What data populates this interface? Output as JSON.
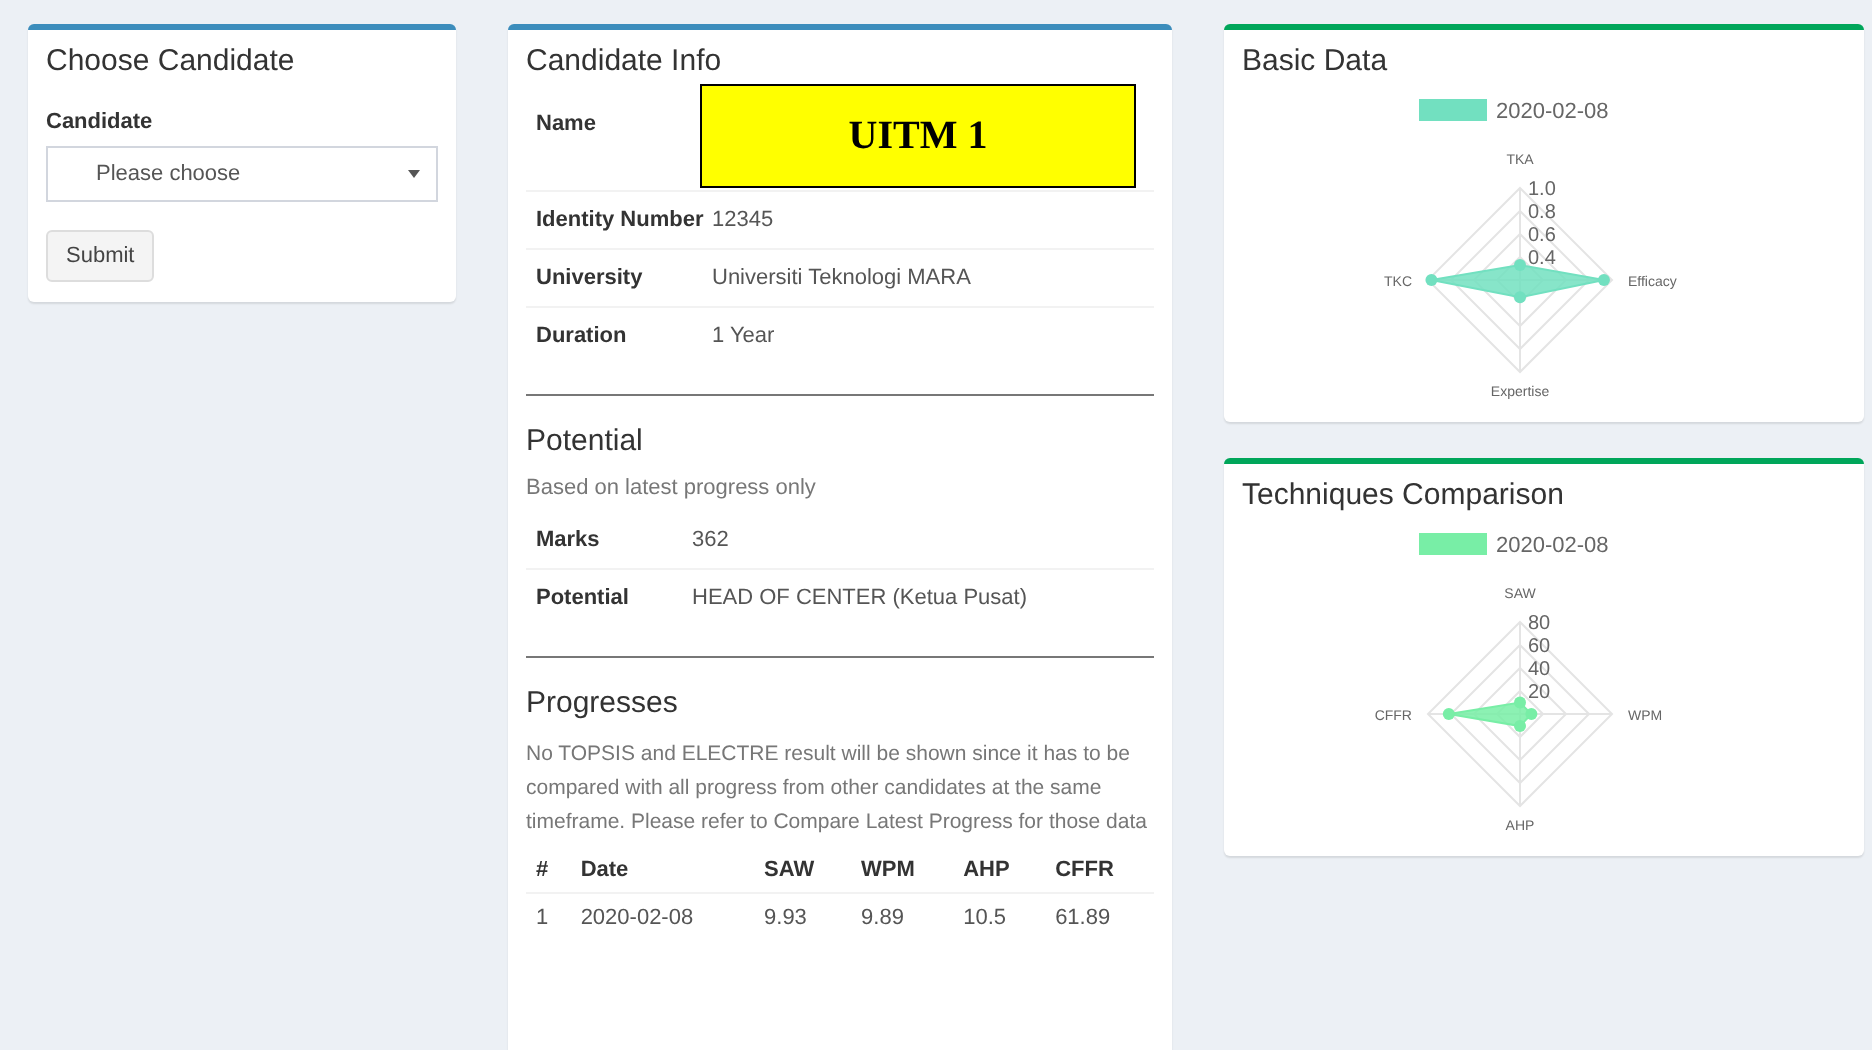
{
  "choose_panel": {
    "title": "Choose Candidate",
    "field_label": "Candidate",
    "select": {
      "value": "Please choose"
    },
    "submit_button": "Submit"
  },
  "info_panel": {
    "title": "Candidate Info",
    "name_label": "Name",
    "name_overlay": "UITM 1",
    "details": [
      {
        "label": "Identity Number",
        "value": "12345"
      },
      {
        "label": "University",
        "value": "Universiti Teknologi MARA"
      },
      {
        "label": "Duration",
        "value": "1 Year"
      }
    ],
    "potential": {
      "title": "Potential",
      "note": "Based on latest progress only",
      "rows": [
        {
          "label": "Marks",
          "value": "362"
        },
        {
          "label": "Potential",
          "value": "HEAD OF CENTER (Ketua Pusat)"
        }
      ]
    },
    "progresses": {
      "title": "Progresses",
      "note": "No TOPSIS and ELECTRE result will be shown since it has to be compared with all progress from other candidates at the same timeframe. Please refer to Compare Latest Progress for those data",
      "columns": [
        "#",
        "Date",
        "SAW",
        "WPM",
        "AHP",
        "CFFR"
      ],
      "rows": [
        [
          "1",
          "2020-02-08",
          "9.93",
          "9.89",
          "10.5",
          "61.89"
        ]
      ]
    }
  },
  "basic_panel": {
    "title": "Basic Data",
    "chart_data": {
      "type": "radar",
      "categories": [
        "TKA",
        "Efficacy",
        "Expertise",
        "TKC"
      ],
      "ylim": [
        0.2,
        1.0
      ],
      "yticks": [
        0.4,
        0.6,
        0.8,
        {
          "value": 1.0,
          "label": "1.0"
        }
      ],
      "series": [
        {
          "name": "2020-02-08",
          "color": "#72e0c0",
          "values": [
            0.33,
            0.93,
            0.35,
            0.97
          ]
        }
      ]
    }
  },
  "techniques_panel": {
    "title": "Techniques Comparison",
    "chart_data": {
      "type": "radar",
      "categories": [
        "SAW",
        "WPM",
        "AHP",
        "CFFR"
      ],
      "ylim": [
        0,
        80
      ],
      "yticks": [
        20,
        40,
        60,
        80
      ],
      "series": [
        {
          "name": "2020-02-08",
          "color": "#78eea6",
          "values": [
            9.93,
            9.89,
            10.5,
            61.89
          ]
        }
      ]
    }
  }
}
